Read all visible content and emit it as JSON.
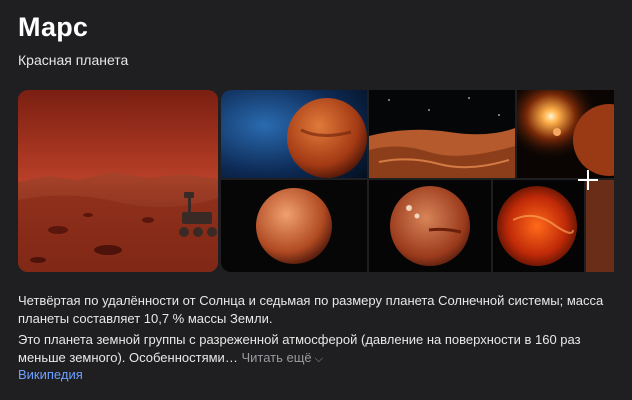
{
  "header": {
    "title": "Марс",
    "subtitle": "Красная планета"
  },
  "gallery": {
    "images": [
      {
        "name": "mars-surface-rover"
      },
      {
        "name": "mars-space-blue"
      },
      {
        "name": "mars-terrain-closeup"
      },
      {
        "name": "mars-with-sun"
      },
      {
        "name": "mars-globe-black"
      },
      {
        "name": "mars-globe-craters"
      },
      {
        "name": "mars-globe-fiery"
      }
    ],
    "more_icon": "plus-icon"
  },
  "description": {
    "paragraph1": "Четвёртая по удалённости от Солнца и седьмая по размеру планета Солнечной системы; масса планеты составляет 10,7 % массы Земли.",
    "paragraph2": "Это планета земной группы с разреженной атмосферой (давление на поверхности в 160 раз меньше земного). Особенностями…",
    "read_more": "Читать ещё",
    "read_more_icon": "chevron-down-icon"
  },
  "source": {
    "label": "Википедия"
  },
  "colors": {
    "background": "#1f1f21",
    "text": "#e8e8e8",
    "muted": "#9a9a9f",
    "link": "#6da0ff"
  }
}
